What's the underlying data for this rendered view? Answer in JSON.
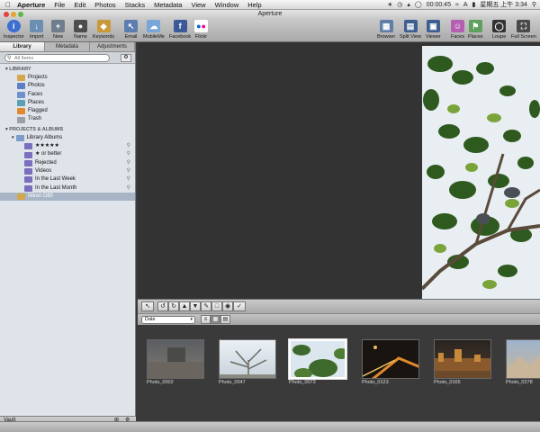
{
  "menubar": {
    "apple": "",
    "app": "Aperture",
    "items": [
      "File",
      "Edit",
      "Photos",
      "Stacks",
      "Metadata",
      "View",
      "Window",
      "Help"
    ],
    "timer": "00:00:45",
    "clock": "星期五 上午 3:34",
    "lang": "A"
  },
  "window": {
    "title": "Aperture"
  },
  "toolbar": {
    "left": [
      {
        "label": "Inspector",
        "icon": "info-icon",
        "color": "#3b6fd0"
      },
      {
        "label": "Import",
        "icon": "import-arrow-icon",
        "color": "#6b8fb3"
      },
      {
        "label": "New",
        "icon": "new-folder-icon",
        "color": "#6f7d8c"
      },
      {
        "label": "Name",
        "icon": "person-icon",
        "color": "#4d4d4d"
      },
      {
        "label": "Keywords",
        "icon": "tag-icon",
        "color": "#c89a3a"
      },
      {
        "label": "Email",
        "icon": "pointer-icon",
        "color": "#5d7db1"
      },
      {
        "label": "MobileMe",
        "icon": "cloud-icon",
        "color": "#78a6d6"
      },
      {
        "label": "Facebook",
        "icon": "facebook-icon",
        "color": "#3b5998"
      },
      {
        "label": "Flickr",
        "icon": "flickr-icon",
        "color": "#ffffff"
      }
    ],
    "right": [
      {
        "label": "Browser",
        "icon": "grid-icon",
        "color": "#5f7fa8"
      },
      {
        "label": "Split View",
        "icon": "split-view-icon",
        "color": "#3d5f8f"
      },
      {
        "label": "Viewer",
        "icon": "viewer-icon",
        "color": "#3d5f8f"
      },
      {
        "label": "Faces",
        "icon": "faces-icon",
        "color": "#b55fb0"
      },
      {
        "label": "Places",
        "icon": "places-icon",
        "color": "#5fa05f"
      },
      {
        "label": "Loupe",
        "icon": "loupe-icon",
        "color": "#333333"
      },
      {
        "label": "Full Screen",
        "icon": "full-screen-icon",
        "color": "#4a4a4a"
      }
    ]
  },
  "sidebar": {
    "tabs": [
      "Library",
      "Metadata",
      "Adjustments"
    ],
    "search_placeholder": "All Items",
    "library_header": "LIBRARY",
    "library_items": [
      {
        "label": "Projects",
        "color": "#d6a64b"
      },
      {
        "label": "Photos",
        "color": "#5b7fc4"
      },
      {
        "label": "Faces",
        "color": "#6f8fcf"
      },
      {
        "label": "Places",
        "color": "#5aa0b5"
      },
      {
        "label": "Flagged",
        "color": "#e08a2c"
      },
      {
        "label": "Trash",
        "color": "#9aa0a6"
      }
    ],
    "projects_header": "PROJECTS & ALBUMS",
    "albums_group": "Library Albums",
    "smart_albums": [
      "★★★★★",
      "★ or better",
      "Rejected",
      "Videos",
      "In the Last Week",
      "In the Last Month"
    ],
    "project": "Nikon D80",
    "vault": "Vault"
  },
  "browser": {
    "sort": "Date",
    "photos": [
      {
        "name": "Photo_0002",
        "c1": "#5b5e62",
        "c2": "#7f7a74"
      },
      {
        "name": "Photo_0047",
        "c1": "#dfe7ef",
        "c2": "#8a8a80"
      },
      {
        "name": "Photo_0073",
        "c1": "#dbe6ee",
        "c2": "#3d6a2c"
      },
      {
        "name": "Photo_0123",
        "c1": "#1a1410",
        "c2": "#d97a24"
      },
      {
        "name": "Photo_0165",
        "c1": "#2a2420",
        "c2": "#c78a3a"
      },
      {
        "name": "Photo_0278",
        "c1": "#9db3cc",
        "c2": "#c9b69a"
      }
    ]
  }
}
